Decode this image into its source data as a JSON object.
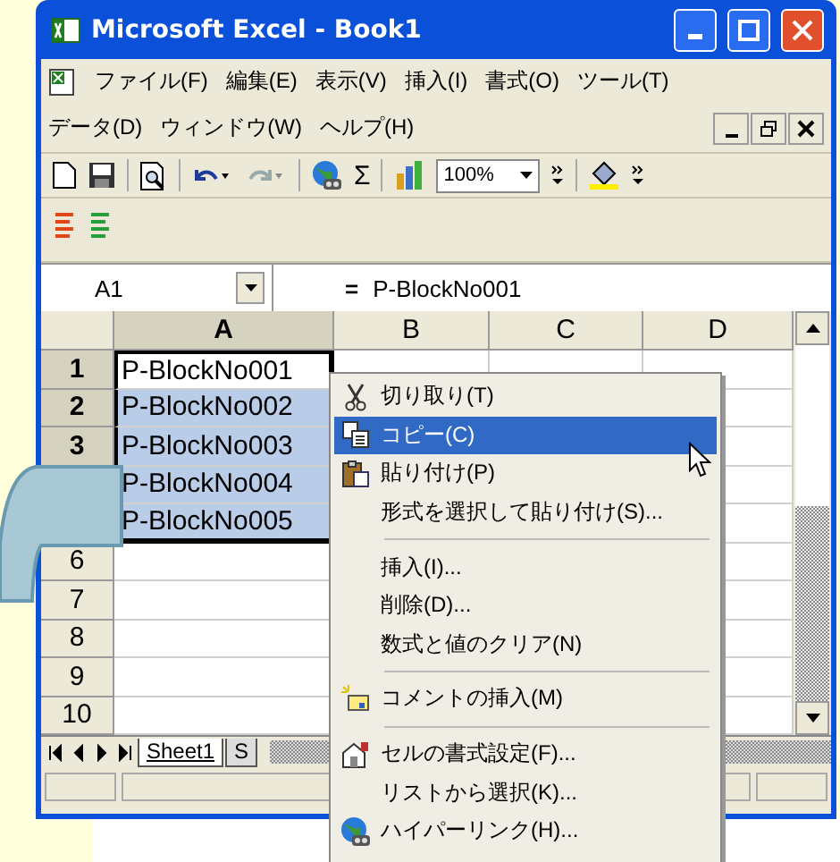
{
  "window": {
    "title": "Microsoft Excel - Book1"
  },
  "menu_bar": {
    "items": [
      "ファイル(F)",
      "編集(E)",
      "表示(V)",
      "挿入(I)",
      "書式(O)",
      "ツール(T)",
      "データ(D)",
      "ウィンドウ(W)",
      "ヘルプ(H)"
    ]
  },
  "toolbar": {
    "sum": "Σ",
    "zoom": "100%"
  },
  "formula_bar": {
    "name_box": "A1",
    "equals": "=",
    "value": "P-BlockNo001"
  },
  "grid": {
    "columns": [
      {
        "label": "A",
        "selected": true
      },
      {
        "label": "B",
        "selected": false
      },
      {
        "label": "C",
        "selected": false
      },
      {
        "label": "D",
        "selected": false
      }
    ],
    "rows": [
      {
        "header": "1",
        "cell": "P-BlockNo001",
        "selected": true,
        "active": true
      },
      {
        "header": "2",
        "cell": "P-BlockNo002",
        "selected": true,
        "active": false
      },
      {
        "header": "3",
        "cell": "P-BlockNo003",
        "selected": true,
        "active": false
      },
      {
        "cell": "P-BlockNo004",
        "selected": true,
        "active": false
      },
      {
        "cell": "P-BlockNo005",
        "selected": true,
        "active": false
      },
      {
        "header": "6",
        "selected": false,
        "active": false
      },
      {
        "header": "7",
        "selected": false,
        "active": false
      },
      {
        "header": "8",
        "selected": false,
        "active": false
      },
      {
        "header": "9",
        "selected": false,
        "active": false
      },
      {
        "header": "10",
        "selected": false,
        "active": false
      }
    ]
  },
  "sheet_tabs": [
    {
      "label": "Sheet1",
      "selected": true
    },
    {
      "label": "S",
      "selected": false
    }
  ],
  "context_menu": {
    "items": [
      {
        "kind": "item",
        "label": "切り取り(T)",
        "selected": false
      },
      {
        "kind": "item",
        "label": "コピー(C)",
        "selected": true
      },
      {
        "kind": "item",
        "label": "貼り付け(P)",
        "selected": false
      },
      {
        "kind": "item",
        "label": "形式を選択して貼り付け(S)...",
        "selected": false
      },
      {
        "kind": "separator"
      },
      {
        "kind": "item",
        "label": "挿入(I)...",
        "selected": false
      },
      {
        "kind": "item",
        "label": "削除(D)...",
        "selected": false
      },
      {
        "kind": "item",
        "label": "数式と値のクリア(N)",
        "selected": false
      },
      {
        "kind": "separator"
      },
      {
        "kind": "item",
        "label": "コメントの挿入(M)",
        "selected": false
      },
      {
        "kind": "separator"
      },
      {
        "kind": "item",
        "label": "セルの書式設定(F)...",
        "selected": false
      },
      {
        "kind": "item",
        "label": "リストから選択(K)...",
        "selected": false
      },
      {
        "kind": "item",
        "label": "ハイパーリンク(H)...",
        "selected": false
      }
    ]
  }
}
